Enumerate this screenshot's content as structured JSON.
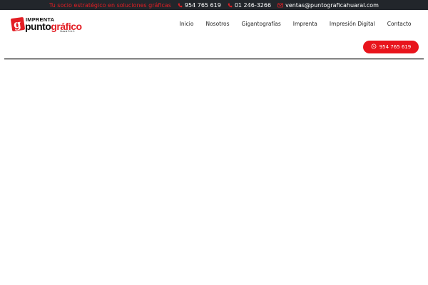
{
  "topbar": {
    "tagline": "Tu socio estratégico en soluciones gráficas",
    "phone1": "954 765 619",
    "phone2": "01 246-3266",
    "email": "ventas@puntograficahuaral.com",
    "icons": [
      "phone-icon",
      "phone-icon",
      "mail-icon"
    ],
    "colors": {
      "background": "#22262b",
      "tagline": "#e31e24",
      "text": "#ffffff"
    }
  },
  "logo": {
    "mark": "g",
    "line1": "IMPRENTA",
    "line2a": "punto",
    "line2b": "gráfico",
    "line3": "Huaral S.A.C."
  },
  "nav": {
    "items": [
      "Inicio",
      "Nosotros",
      "Gigantografías",
      "Imprenta",
      "Impresión Digital",
      "Contacto"
    ]
  },
  "whatsapp_button": {
    "label": "954 765 619",
    "icon": "whatsapp-icon",
    "color": "#e8141c"
  }
}
